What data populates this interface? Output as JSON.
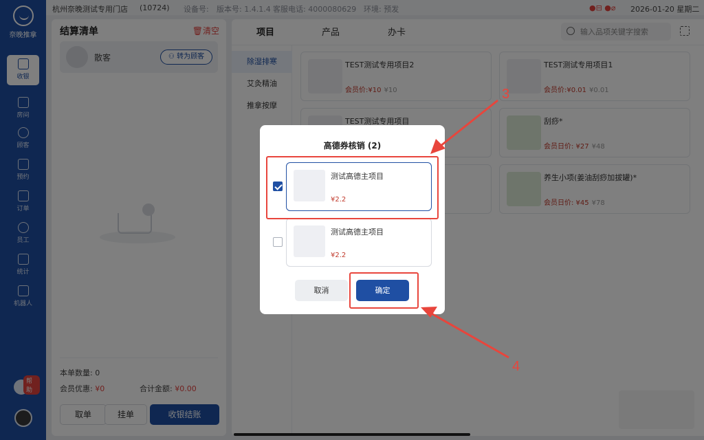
{
  "app": {
    "logo_text": "奈晚推拿"
  },
  "nav": [
    {
      "label": "收银",
      "icon": "cashier-icon",
      "active": true
    },
    {
      "label": "房间",
      "icon": "home-icon"
    },
    {
      "label": "顾客",
      "icon": "user-icon"
    },
    {
      "label": "预约",
      "icon": "calendar-icon"
    },
    {
      "label": "订单",
      "icon": "order-icon"
    },
    {
      "label": "员工",
      "icon": "staff-icon"
    },
    {
      "label": "统计",
      "icon": "chart-icon"
    },
    {
      "label": "机器人",
      "icon": "robot-icon"
    }
  ],
  "help_label": "帮助",
  "status": {
    "store": "杭州奈晚测试专用门店",
    "store_code": "(10724)",
    "device": "设备号:",
    "version": "版本号: 1.4.1.4",
    "phone": "客服电话: 4000080629",
    "env": "环境: 预发",
    "datetime": "2026-01-20 星期二"
  },
  "cart": {
    "title": "结算清单",
    "clear_label": "清空",
    "customer_name": "散客",
    "to_member_label": "转为顾客",
    "count_label": "本单数量:",
    "count_value": "0",
    "discount_label": "会员优惠:",
    "discount_value": "¥0",
    "total_label": "合计金额:",
    "total_value": "¥0.00",
    "btn_cancel": "取单",
    "btn_hold": "挂单",
    "btn_checkout": "收银结账"
  },
  "catalog": {
    "tabs": [
      "项目",
      "产品",
      "办卡"
    ],
    "search_placeholder": "输入品项关键字搜索",
    "categories": [
      "除湿排寒",
      "艾灸精油",
      "推拿按摩"
    ],
    "cards": [
      {
        "name": "TEST测试专用项目2",
        "member_label": "会员价:¥10",
        "price": "¥10"
      },
      {
        "name": "TEST测试专用项目1",
        "member_label": "会员价:¥0.01",
        "price": "¥0.01"
      },
      {
        "name": "TEST测试专用项目",
        "member_label": "",
        "price": ""
      },
      {
        "name": "刮痧*",
        "member_label": "会员日价: ¥27",
        "price": "¥48"
      },
      {
        "name": "",
        "member_label": "",
        "price": ""
      },
      {
        "name": "养生小项(姜油刮痧加拔罐)*",
        "member_label": "会员日价: ¥45",
        "price": "¥78"
      }
    ]
  },
  "modal": {
    "title": "高德券核销 (2)",
    "coupons": [
      {
        "name": "测试高德主项目",
        "price": "¥2.2",
        "checked": true
      },
      {
        "name": "测试高德主项目",
        "price": "¥2.2",
        "checked": false
      }
    ],
    "cancel_label": "取消",
    "confirm_label": "确定"
  },
  "annotations": {
    "step3": "3",
    "step4": "4",
    "color": "#e8453c"
  }
}
